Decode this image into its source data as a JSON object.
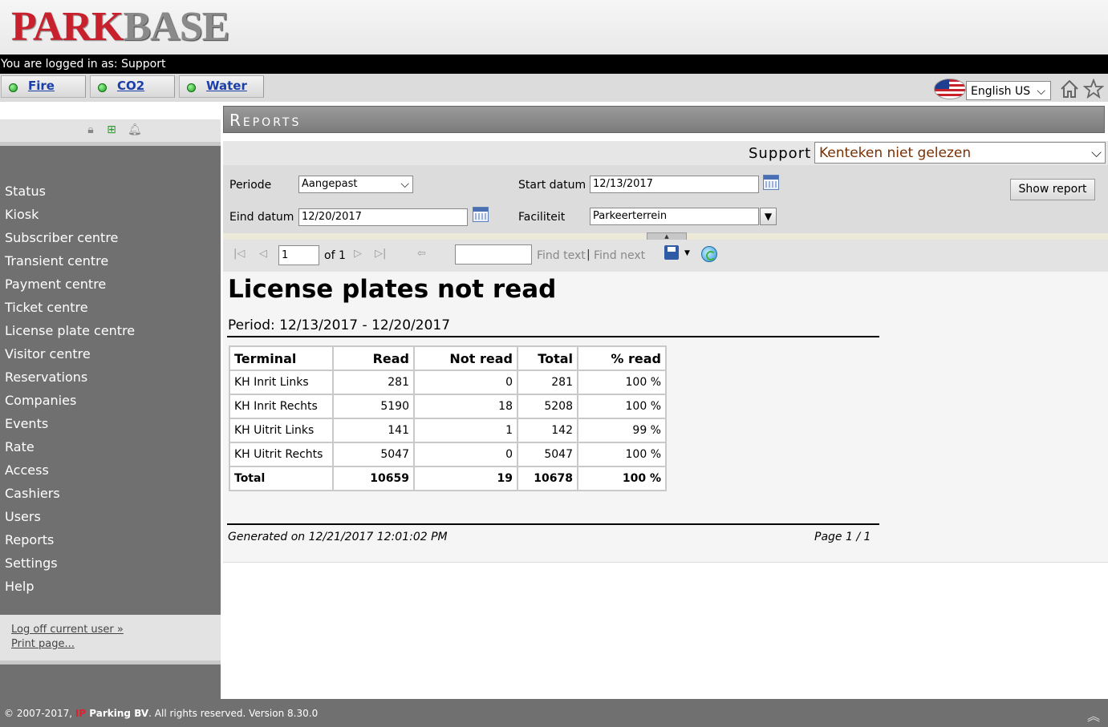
{
  "header": {
    "logo_park": "PARK",
    "logo_base": "BASE",
    "login_text": "You are logged in as: Support"
  },
  "alarms": [
    {
      "label": "Fire",
      "status_color": "#2bb52b"
    },
    {
      "label": "CO2",
      "status_color": "#2bb52b"
    },
    {
      "label": "Water",
      "status_color": "#2bb52b"
    }
  ],
  "language": {
    "selected": "English US"
  },
  "sidebar": {
    "items": [
      "Status",
      "Kiosk",
      "Subscriber centre",
      "Transient centre",
      "Payment centre",
      "Ticket centre",
      "License plate centre",
      "Visitor centre",
      "Reservations",
      "Companies",
      "Events",
      "Rate",
      "Access",
      "Cashiers",
      "Users",
      "Reports",
      "Settings",
      "Help"
    ],
    "logoff": "Log off current user »",
    "print": "Print page..."
  },
  "main": {
    "title": "Reports",
    "support_label": "Support",
    "report_selected": "Kenteken niet gelezen",
    "params": {
      "periode_label": "Periode",
      "periode_value": "Aangepast",
      "start_label": "Start datum",
      "start_value": "12/13/2017",
      "eind_label": "Eind datum",
      "eind_value": "12/20/2017",
      "faciliteit_label": "Faciliteit",
      "faciliteit_value": "Parkeerterrein"
    },
    "show_report": "Show report",
    "toolbar": {
      "page": "1",
      "of": "of 1",
      "find_text": "Find text",
      "sep": "|",
      "find_next": "Find next"
    }
  },
  "report": {
    "title": "License plates not read",
    "period": "Period: 12/13/2017 - 12/20/2017",
    "columns": [
      "Terminal",
      "Read",
      "Not read",
      "Total",
      "% read"
    ],
    "rows": [
      [
        "KH Inrit Links",
        "281",
        "0",
        "281",
        "100 %"
      ],
      [
        "KH Inrit Rechts",
        "5190",
        "18",
        "5208",
        "100 %"
      ],
      [
        "KH Uitrit Links",
        "141",
        "1",
        "142",
        "99 %"
      ],
      [
        "KH Uitrit Rechts",
        "5047",
        "0",
        "5047",
        "100 %"
      ]
    ],
    "total": [
      "Total",
      "10659",
      "19",
      "10678",
      "100 %"
    ],
    "generated": "Generated on 12/21/2017 12:01:02 PM",
    "page_info": "Page 1 / 1"
  },
  "footer": {
    "pre": "© 2007-2017, ",
    "ip": "IP",
    "company": " Parking BV",
    "post": ". All rights reserved. Version 8.30.0"
  }
}
